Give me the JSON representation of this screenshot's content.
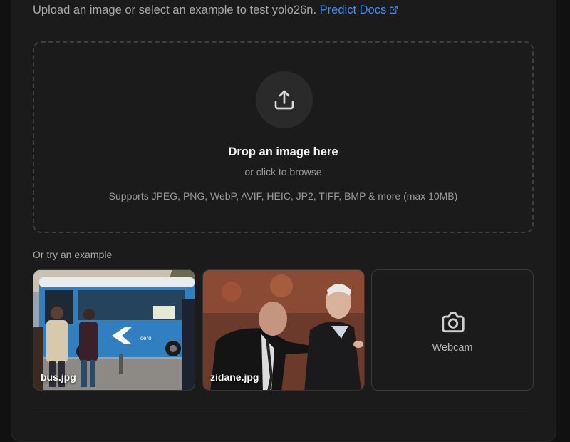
{
  "intro": {
    "text": "Upload an image or select an example to test yolo26n.",
    "link_label": "Predict Docs",
    "link_icon": "external-link-icon"
  },
  "dropzone": {
    "icon": "upload-icon",
    "title": "Drop an image here",
    "subtitle": "or click to browse",
    "formats": "Supports JPEG, PNG, WebP, AVIF, HEIC, JP2, TIFF, BMP & more (max 10MB)"
  },
  "examples": {
    "label": "Or try an example",
    "items": [
      {
        "caption": "bus.jpg"
      },
      {
        "caption": "zidane.jpg"
      },
      {
        "caption": "Webcam",
        "icon": "camera-icon"
      }
    ]
  },
  "colors": {
    "background": "#111111",
    "panel": "#1b1b1b",
    "link": "#3b8ff0",
    "text_muted": "#a8a8a8"
  }
}
